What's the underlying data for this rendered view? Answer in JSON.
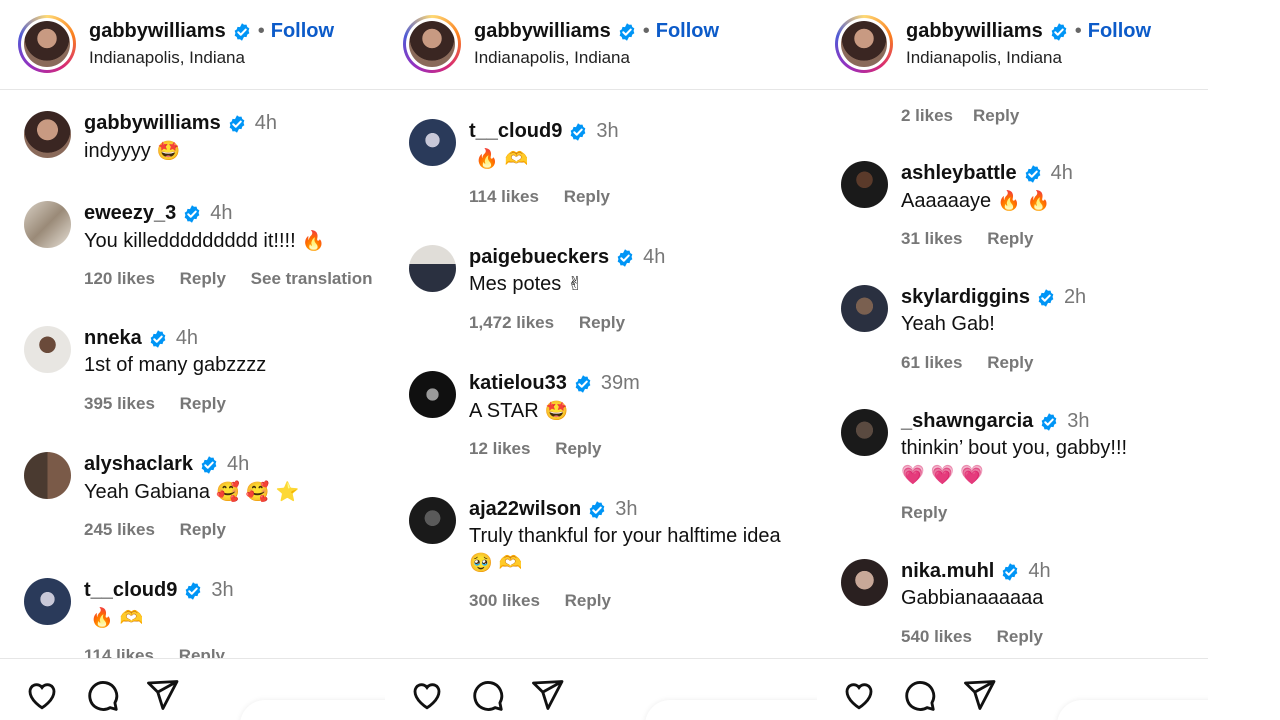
{
  "header": {
    "username": "gabbywilliams",
    "separator": "•",
    "follow_label": "Follow",
    "location": "Indianapolis, Indiana"
  },
  "panels": [
    {
      "comments": [
        {
          "username": "gabbywilliams",
          "time": "4h",
          "text": "indyyyy",
          "emoji": "🤩"
        },
        {
          "username": "eweezy_3",
          "time": "4h",
          "text": "You killeddddddddd it!!!!",
          "emoji": "🔥",
          "likes": "120 likes",
          "reply": "Reply",
          "translate": "See translation"
        },
        {
          "username": "nneka",
          "time": "4h",
          "text": "1st of many gabzzzz",
          "likes": "395 likes",
          "reply": "Reply"
        },
        {
          "username": "alyshaclark",
          "time": "4h",
          "text": "Yeah Gabiana",
          "emoji": "🥰 🥰 ⭐",
          "likes": "245 likes",
          "reply": "Reply"
        },
        {
          "username": "t__cloud9",
          "time": "3h",
          "text": "",
          "emoji": "🔥 🫶",
          "likes": "114 likes",
          "reply": "Reply"
        }
      ]
    },
    {
      "comments": [
        {
          "username": "t__cloud9",
          "time": "3h",
          "text": "",
          "emoji": "🔥 🫶",
          "likes": "114 likes",
          "reply": "Reply"
        },
        {
          "username": "paigebueckers",
          "time": "4h",
          "text": "Mes potes",
          "emoji": "✌",
          "likes": "1,472 likes",
          "reply": "Reply"
        },
        {
          "username": "katielou33",
          "time": "39m",
          "text": "A STAR",
          "emoji": "🤩",
          "likes": "12 likes",
          "reply": "Reply"
        },
        {
          "username": "aja22wilson",
          "time": "3h",
          "text": "Truly thankful for your halftime idea",
          "text2": "🥹 🫶",
          "likes": "300 likes",
          "reply": "Reply"
        }
      ]
    },
    {
      "top_meta": {
        "likes": "2 likes",
        "reply": "Reply"
      },
      "comments": [
        {
          "username": "ashleybattle",
          "time": "4h",
          "text": "Aaaaaaye",
          "emoji": "🔥 🔥",
          "likes": "31 likes",
          "reply": "Reply"
        },
        {
          "username": "skylardiggins",
          "time": "2h",
          "text": "Yeah Gab!",
          "likes": "61 likes",
          "reply": "Reply"
        },
        {
          "username": "_shawngarcia",
          "time": "3h",
          "text": "thinkin’ bout you, gabby!!!",
          "text2": "💗 💗 💗",
          "reply": "Reply"
        },
        {
          "username": "nika.muhl",
          "time": "4h",
          "text": "Gabbianaaaaaa",
          "likes": "540 likes",
          "reply": "Reply"
        }
      ]
    }
  ],
  "colors": {
    "follow": "#0c5bc9",
    "verified": "#0095f6",
    "muted": "#777777"
  },
  "icons": [
    "heart-icon",
    "comment-icon",
    "share-icon",
    "verified-badge-icon"
  ]
}
